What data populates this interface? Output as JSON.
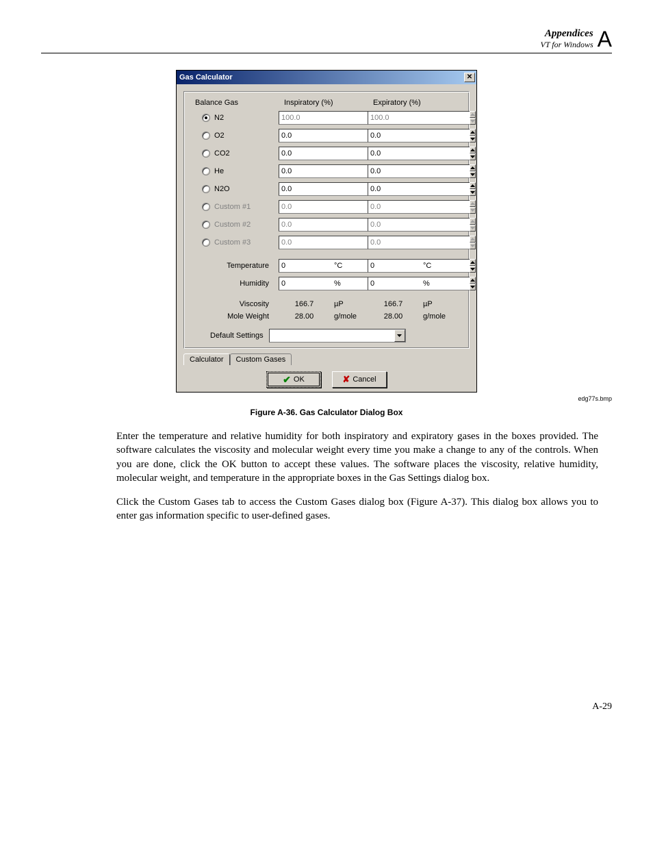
{
  "header": {
    "title": "Appendices",
    "subtitle": "VT for Windows",
    "letter": "A"
  },
  "dialog": {
    "title": "Gas Calculator",
    "headers": {
      "balance": "Balance Gas",
      "insp": "Inspiratory (%)",
      "exp": "Expiratory (%)"
    },
    "gases": [
      {
        "label": "N2",
        "disabled": false,
        "selected": true,
        "insp": "100.0",
        "exp": "100.0",
        "insp_disabled": true,
        "exp_disabled": true
      },
      {
        "label": "O2",
        "disabled": false,
        "selected": false,
        "insp": "0.0",
        "exp": "0.0",
        "insp_disabled": false,
        "exp_disabled": false
      },
      {
        "label": "CO2",
        "disabled": false,
        "selected": false,
        "insp": "0.0",
        "exp": "0.0",
        "insp_disabled": false,
        "exp_disabled": false
      },
      {
        "label": "He",
        "disabled": false,
        "selected": false,
        "insp": "0.0",
        "exp": "0.0",
        "insp_disabled": false,
        "exp_disabled": false
      },
      {
        "label": "N2O",
        "disabled": false,
        "selected": false,
        "insp": "0.0",
        "exp": "0.0",
        "insp_disabled": false,
        "exp_disabled": false
      },
      {
        "label": "Custom #1",
        "disabled": true,
        "selected": false,
        "insp": "0.0",
        "exp": "0.0",
        "insp_disabled": true,
        "exp_disabled": true
      },
      {
        "label": "Custom #2",
        "disabled": true,
        "selected": false,
        "insp": "0.0",
        "exp": "0.0",
        "insp_disabled": true,
        "exp_disabled": true
      },
      {
        "label": "Custom #3",
        "disabled": true,
        "selected": false,
        "insp": "0.0",
        "exp": "0.0",
        "insp_disabled": true,
        "exp_disabled": true
      }
    ],
    "env": {
      "temperature_label": "Temperature",
      "humidity_label": "Humidity",
      "temp_insp": "0",
      "temp_exp": "0",
      "temp_unit": "°C",
      "hum_insp": "0",
      "hum_exp": "0",
      "hum_unit": "%"
    },
    "calc": {
      "viscosity_label": "Viscosity",
      "mole_label": "Mole Weight",
      "visc_insp": "166.7",
      "visc_exp": "166.7",
      "visc_unit": "µP",
      "mole_insp": "28.00",
      "mole_exp": "28.00",
      "mole_unit": "g/mole"
    },
    "default_label": "Default Settings",
    "default_value": "",
    "tabs": {
      "calculator": "Calculator",
      "custom": "Custom Gases"
    },
    "buttons": {
      "ok": "OK",
      "cancel": "Cancel"
    }
  },
  "side_caption": "edg77s.bmp",
  "figure_caption": "Figure A-36. Gas Calculator Dialog Box",
  "para1": "Enter the temperature and relative humidity for both inspiratory and expiratory gases in the boxes provided. The software calculates the viscosity and molecular weight every time you make a change to any of the controls. When you are done, click the OK button to accept these values. The software places the viscosity, relative humidity, molecular weight, and temperature in the appropriate boxes in the Gas Settings dialog box.",
  "para2": "Click the Custom Gases tab to access the Custom Gases dialog box (Figure A-37). This dialog box allows you to enter gas information specific to user-defined gases.",
  "page_number": "A-29"
}
